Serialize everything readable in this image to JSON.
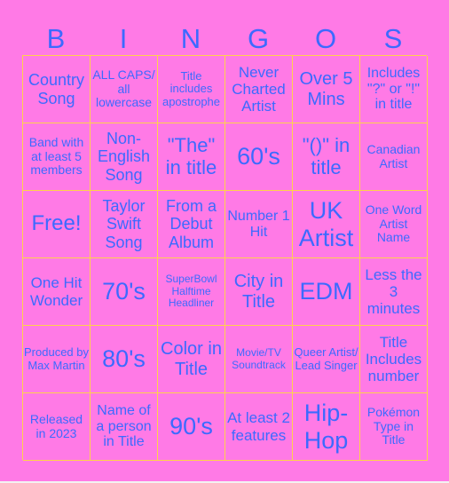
{
  "header": {
    "letters": [
      "B",
      "I",
      "N",
      "G",
      "O",
      "S"
    ]
  },
  "colors": {
    "background": "#ff7ae6",
    "text": "#3c6aff",
    "grid_line": "#ffd24a"
  },
  "board": {
    "rows": [
      [
        "Country Song",
        "ALL CAPS/ all lowercase",
        "Title includes apostrophe",
        "Never Charted Artist",
        "Over 5 Mins",
        "Includes \"?\" or \"!\" in title"
      ],
      [
        "Band with at least 5 members",
        "Non-English Song",
        "\"The\" in title",
        "60's",
        "\"()\" in title",
        "Canadian Artist"
      ],
      [
        "Free!",
        "Taylor Swift Song",
        "From a Debut Album",
        "Number 1 Hit",
        "UK Artist",
        "One Word Artist Name"
      ],
      [
        "One Hit Wonder",
        "70's",
        "SuperBowl Halftime Headliner",
        "City in Title",
        "EDM",
        "Less the 3 minutes"
      ],
      [
        "Produced by Max Martin",
        "80's",
        "Color in Title",
        "Movie/TV Soundtrack",
        "Queer Artist/ Lead Singer",
        "Title Includes number"
      ],
      [
        "Released in 2023",
        "Name of a person in Title",
        "90's",
        "At least 2 features",
        "Hip-Hop",
        "Pokémon Type in Title"
      ]
    ]
  }
}
